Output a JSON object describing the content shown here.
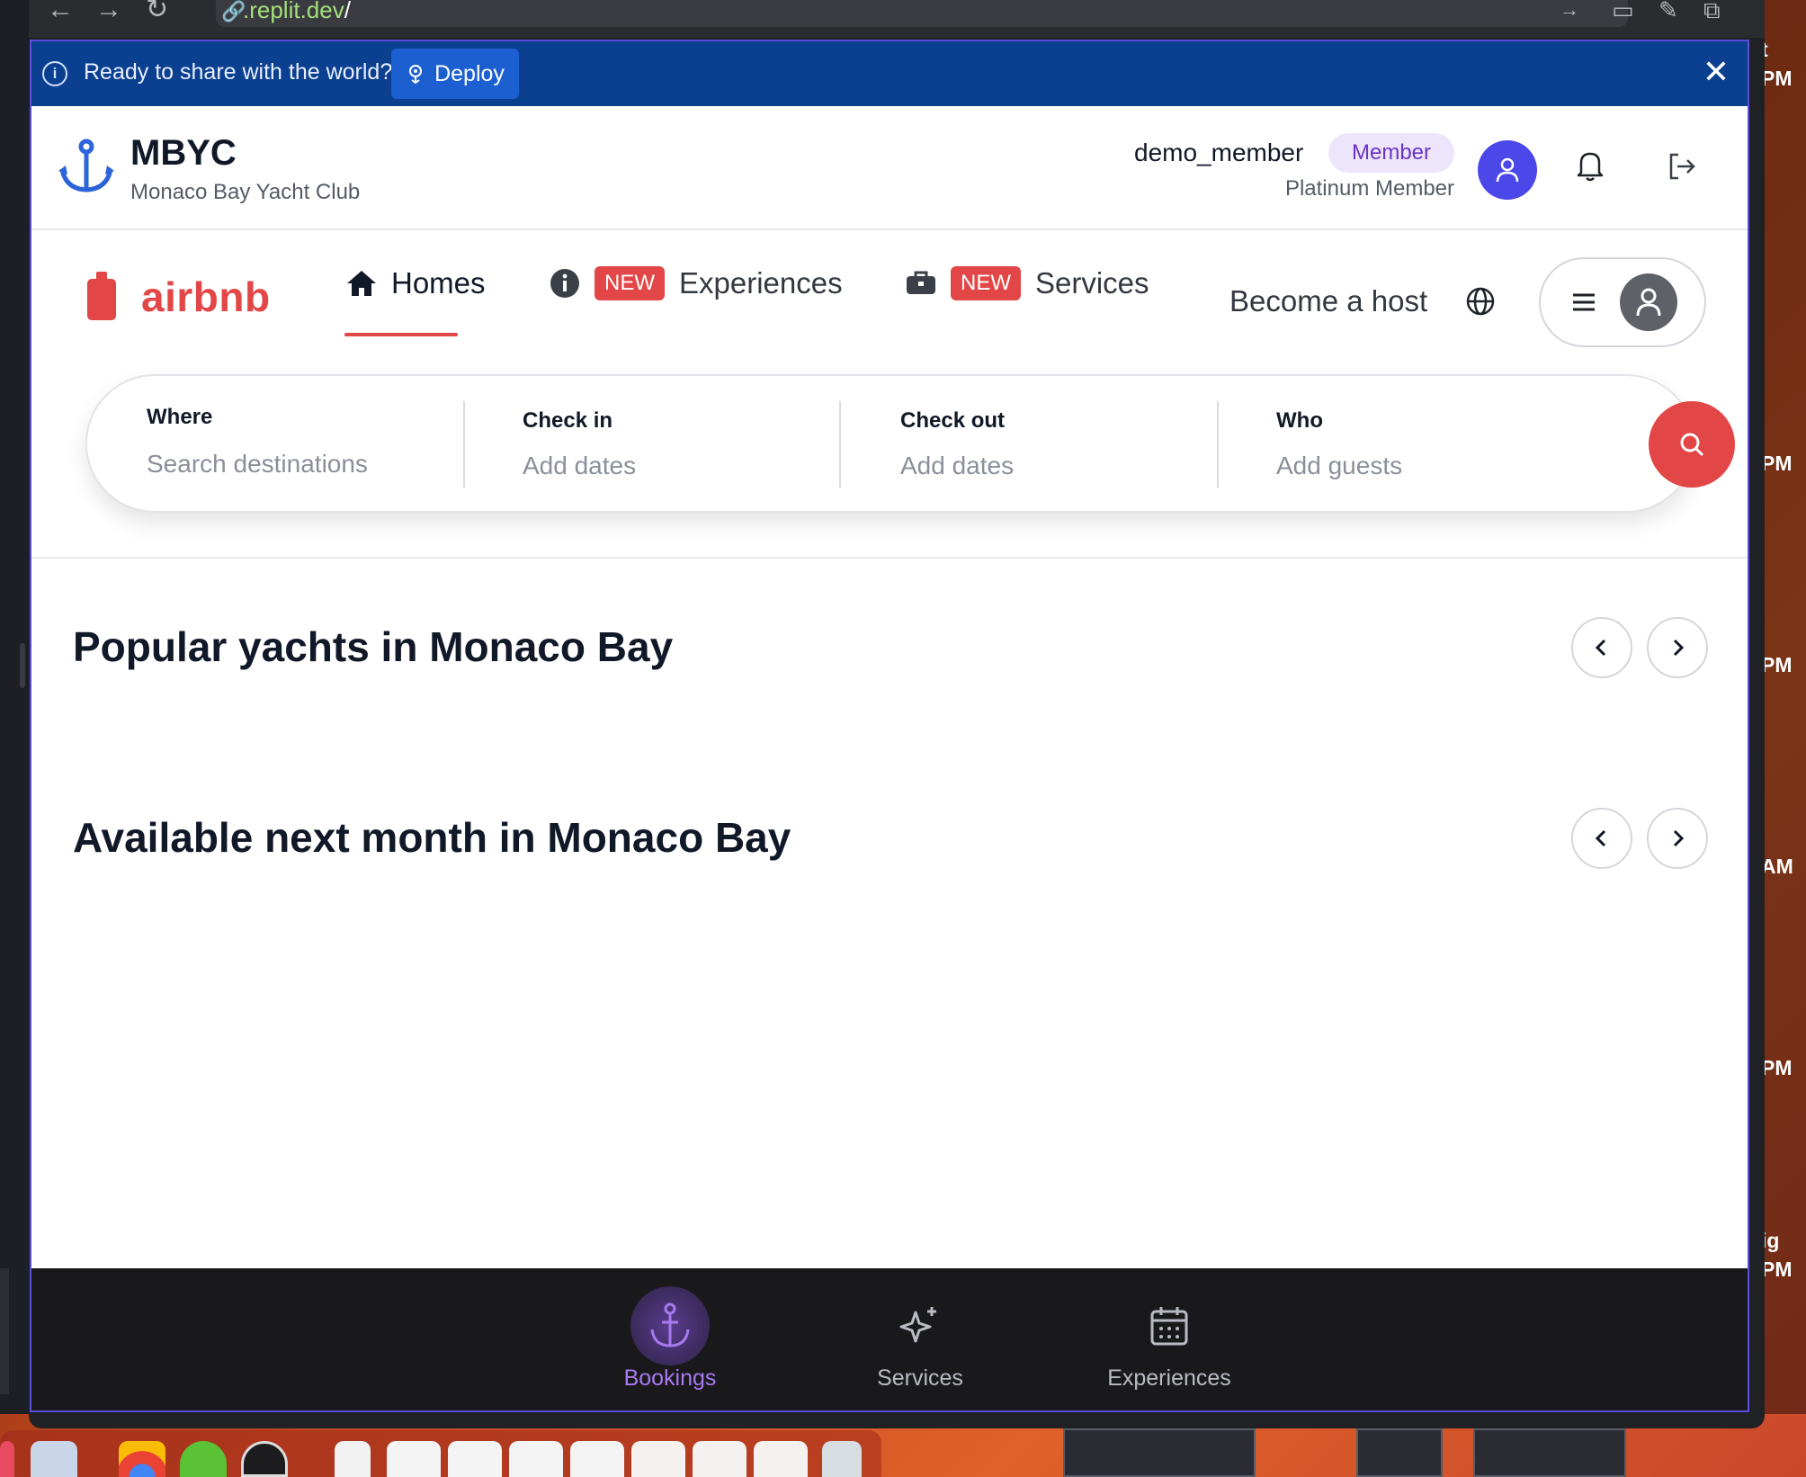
{
  "browser": {
    "address": ".replit.dev",
    "address_slash": "/"
  },
  "side_times": [
    "t",
    "PM",
    "PM",
    "PM",
    "AM",
    "PM",
    "ig",
    "PM"
  ],
  "deploy_bar": {
    "message": "Ready to share with the world?",
    "deploy_label": "Deploy",
    "close_icon": "close-icon"
  },
  "club_header": {
    "title": "MBYC",
    "subtitle": "Monaco Bay Yacht Club",
    "username": "demo_member",
    "role_badge": "Member",
    "tier": "Platinum Member",
    "accent": "#4c47e8"
  },
  "airbnb_nav": {
    "brand": "airbnb",
    "brand_color": "#e24646",
    "tabs": [
      {
        "label": "Homes",
        "icon": "home-icon",
        "active": true
      },
      {
        "label": "Experiences",
        "icon": "info-icon",
        "badge": "NEW"
      },
      {
        "label": "Services",
        "icon": "briefcase-icon",
        "badge": "NEW"
      }
    ],
    "become_host": "Become a host"
  },
  "search": {
    "fields": [
      {
        "label": "Where",
        "placeholder": "Search destinations"
      },
      {
        "label": "Check in",
        "placeholder": "Add dates"
      },
      {
        "label": "Check out",
        "placeholder": "Add dates"
      },
      {
        "label": "Who",
        "placeholder": "Add guests"
      }
    ]
  },
  "sections": [
    {
      "title": "Popular yachts in Monaco Bay"
    },
    {
      "title": "Available next month in Monaco Bay"
    }
  ],
  "bottom_nav": {
    "items": [
      {
        "label": "Bookings",
        "icon": "anchor-icon",
        "active": true
      },
      {
        "label": "Services",
        "icon": "sparkles-icon"
      },
      {
        "label": "Experiences",
        "icon": "calendar-icon"
      }
    ],
    "active_color": "#a77af0"
  }
}
